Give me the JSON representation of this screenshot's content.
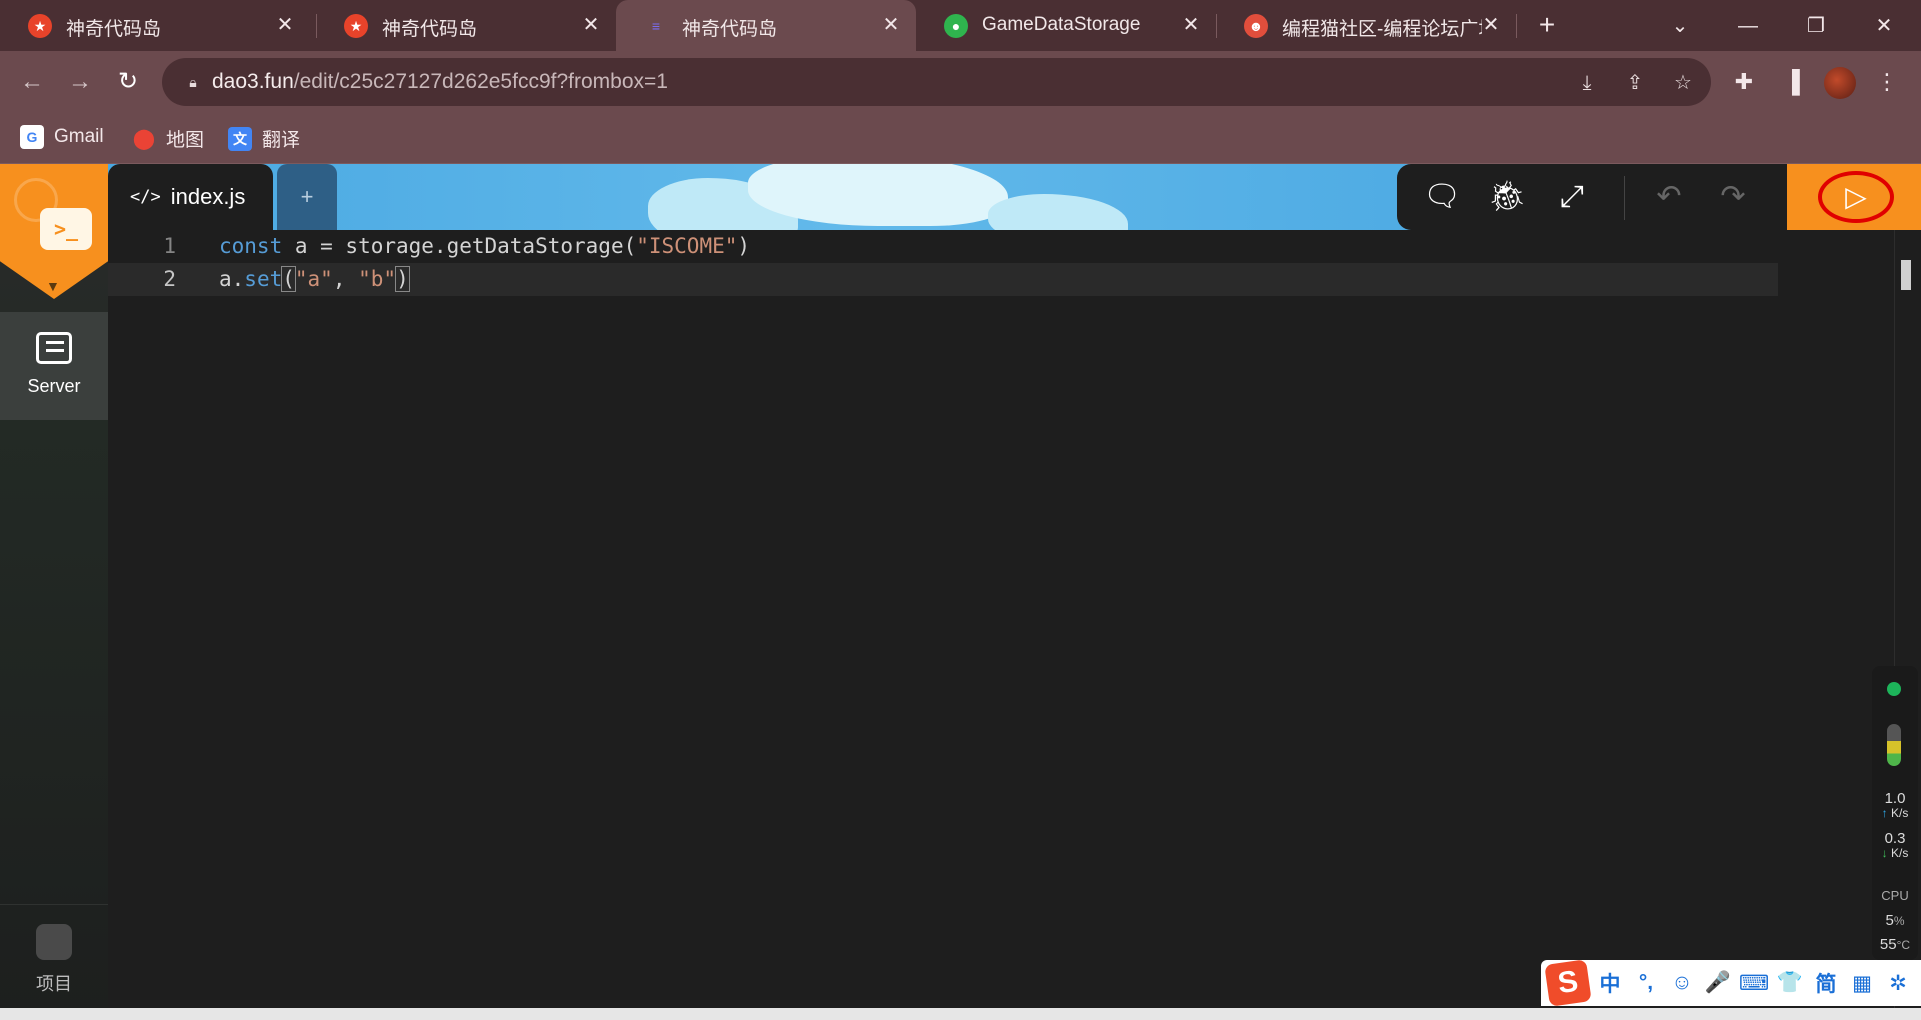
{
  "browser": {
    "tabs": [
      {
        "label": "神奇代码岛",
        "favicon": "star-logo-icon",
        "active": false
      },
      {
        "label": "神奇代码岛",
        "favicon": "star-logo-icon",
        "active": false
      },
      {
        "label": "神奇代码岛",
        "favicon": "code-logo-icon",
        "active": true
      },
      {
        "label": "GameDataStorage",
        "favicon": "green-leaf-icon",
        "active": false
      },
      {
        "label": "编程猫社区-编程论坛广场",
        "favicon": "codemao-icon",
        "active": false
      }
    ],
    "new_tab_symbol": "+",
    "url_host": "dao3.fun",
    "url_path": "/edit/c25c27127d262e5fcc9f?frombox=1",
    "bookmarks": [
      {
        "label": "Gmail",
        "icon": "google-icon"
      },
      {
        "label": "地图",
        "icon": "maps-icon"
      },
      {
        "label": "翻译",
        "icon": "translate-icon"
      }
    ]
  },
  "app": {
    "sidebar": {
      "server_label": "Server",
      "project_label": "项目"
    },
    "editor": {
      "file_tab": "index.js",
      "add_tab": "+",
      "lines": [
        {
          "num": "1"
        },
        {
          "num": "2"
        }
      ]
    },
    "monitor": {
      "up_value": "1.0",
      "up_unit": "K/s",
      "down_value": "0.3",
      "down_unit": "K/s",
      "cpu_label": "CPU",
      "cpu_value": "5",
      "cpu_unit": "%",
      "temp_value": "55",
      "temp_unit": "°C"
    },
    "ime": {
      "logo": "S",
      "items": [
        "中",
        "°,",
        "☺",
        "🎤",
        "⌨",
        "👕",
        "简",
        "▦",
        "✲"
      ]
    }
  },
  "colors": {
    "accent_orange": "#f7901e",
    "run_highlight": "#e00000",
    "tab_bar": "#4a2f33",
    "toolbar": "#6b4a4e"
  }
}
